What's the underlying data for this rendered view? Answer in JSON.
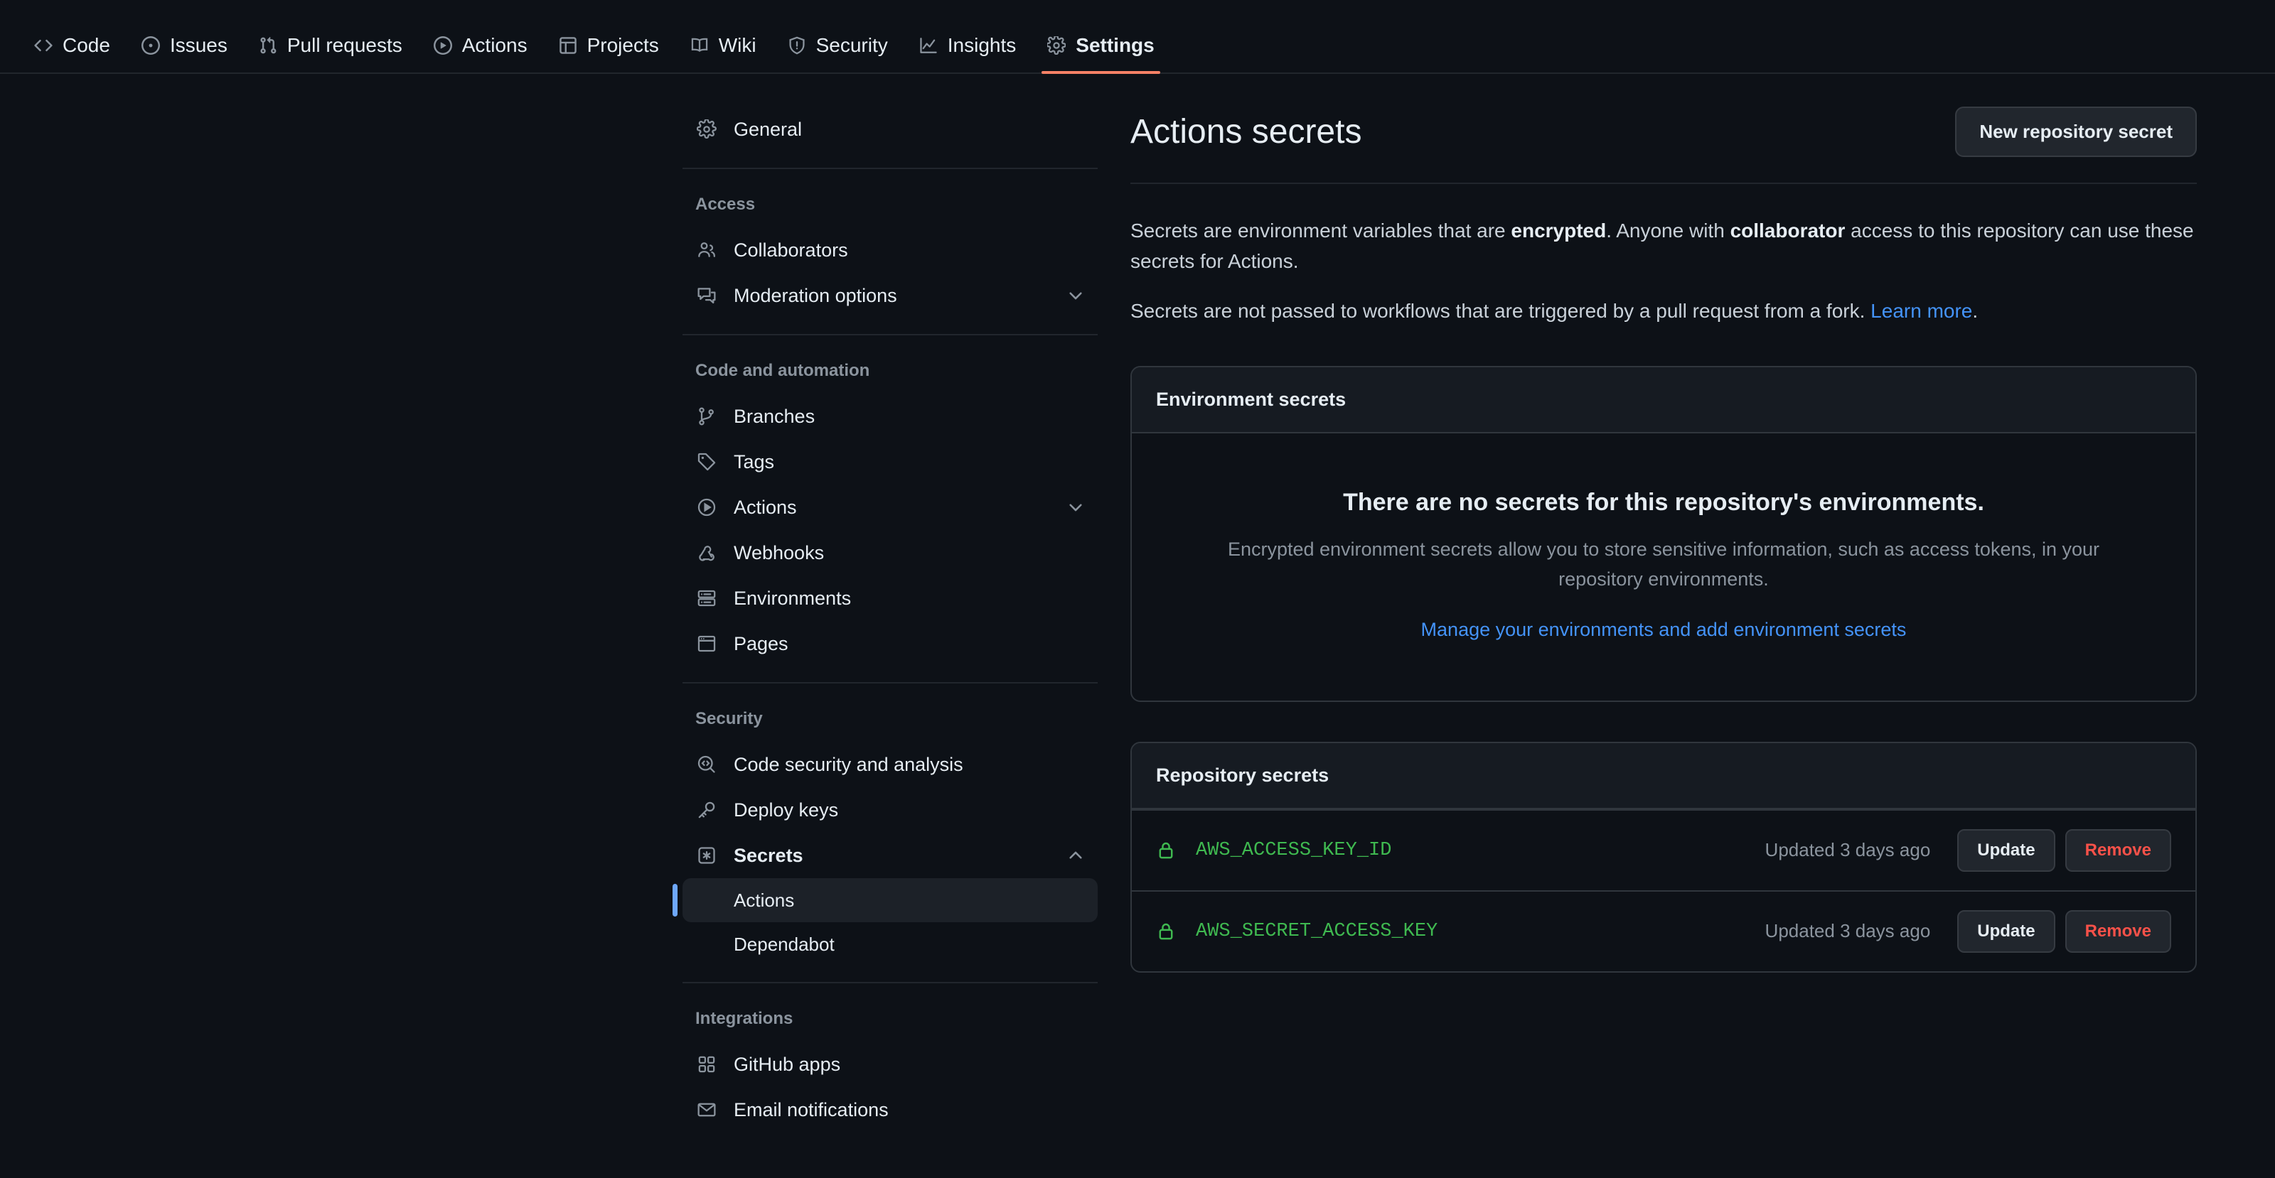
{
  "topnav": {
    "items": [
      {
        "label": "Code",
        "icon": "code-icon",
        "active": false
      },
      {
        "label": "Issues",
        "icon": "issue-opened-icon",
        "active": false
      },
      {
        "label": "Pull requests",
        "icon": "git-pull-request-icon",
        "active": false
      },
      {
        "label": "Actions",
        "icon": "play-icon",
        "active": false
      },
      {
        "label": "Projects",
        "icon": "table-icon",
        "active": false
      },
      {
        "label": "Wiki",
        "icon": "book-icon",
        "active": false
      },
      {
        "label": "Security",
        "icon": "shield-icon",
        "active": false
      },
      {
        "label": "Insights",
        "icon": "graph-icon",
        "active": false
      },
      {
        "label": "Settings",
        "icon": "gear-icon",
        "active": true
      }
    ]
  },
  "sidebar": {
    "general": {
      "label": "General",
      "icon": "gear-icon"
    },
    "groups": [
      {
        "title": "Access",
        "items": [
          {
            "label": "Collaborators",
            "icon": "people-icon",
            "chevron": ""
          },
          {
            "label": "Moderation options",
            "icon": "comment-discussion-icon",
            "chevron": "down"
          }
        ]
      },
      {
        "title": "Code and automation",
        "items": [
          {
            "label": "Branches",
            "icon": "git-branch-icon",
            "chevron": ""
          },
          {
            "label": "Tags",
            "icon": "tag-icon",
            "chevron": ""
          },
          {
            "label": "Actions",
            "icon": "play-icon",
            "chevron": "down"
          },
          {
            "label": "Webhooks",
            "icon": "webhook-icon",
            "chevron": ""
          },
          {
            "label": "Environments",
            "icon": "server-icon",
            "chevron": ""
          },
          {
            "label": "Pages",
            "icon": "browser-icon",
            "chevron": ""
          }
        ]
      },
      {
        "title": "Security",
        "items": [
          {
            "label": "Code security and analysis",
            "icon": "codescan-icon",
            "chevron": ""
          },
          {
            "label": "Deploy keys",
            "icon": "key-icon",
            "chevron": ""
          },
          {
            "label": "Secrets",
            "icon": "asterisk-box-icon",
            "chevron": "up"
          }
        ],
        "subitems": [
          {
            "label": "Actions",
            "active": true
          },
          {
            "label": "Dependabot",
            "active": false
          }
        ]
      },
      {
        "title": "Integrations",
        "items": [
          {
            "label": "GitHub apps",
            "icon": "apps-icon",
            "chevron": ""
          },
          {
            "label": "Email notifications",
            "icon": "mail-icon",
            "chevron": ""
          }
        ]
      }
    ]
  },
  "main": {
    "title": "Actions secrets",
    "new_secret_button": "New repository secret",
    "desc1": {
      "part1": "Secrets are environment variables that are ",
      "bold1": "encrypted",
      "part2": ". Anyone with ",
      "bold2": "collaborator",
      "part3": " access to this repository can use these secrets for Actions."
    },
    "desc2": {
      "text": "Secrets are not passed to workflows that are triggered by a pull request from a fork. ",
      "link": "Learn more",
      "period": "."
    },
    "environment_panel": {
      "header": "Environment secrets",
      "empty_title": "There are no secrets for this repository's environments.",
      "empty_body": "Encrypted environment secrets allow you to store sensitive information, such as access tokens, in your repository environments.",
      "empty_link": "Manage your environments and add environment secrets"
    },
    "repository_panel": {
      "header": "Repository secrets",
      "update_label": "Update",
      "remove_label": "Remove",
      "secrets": [
        {
          "name": "AWS_ACCESS_KEY_ID",
          "updated": "Updated 3 days ago"
        },
        {
          "name": "AWS_SECRET_ACCESS_KEY",
          "updated": "Updated 3 days ago"
        }
      ]
    }
  },
  "colors": {
    "background": "#0d1117",
    "panel_header": "#161b22",
    "border": "#30363d",
    "accent_active_tab": "#f78166",
    "accent_sidebar": "#6ea8fe",
    "link": "#4493f8",
    "secret_green": "#3fb950",
    "danger": "#f85149"
  }
}
